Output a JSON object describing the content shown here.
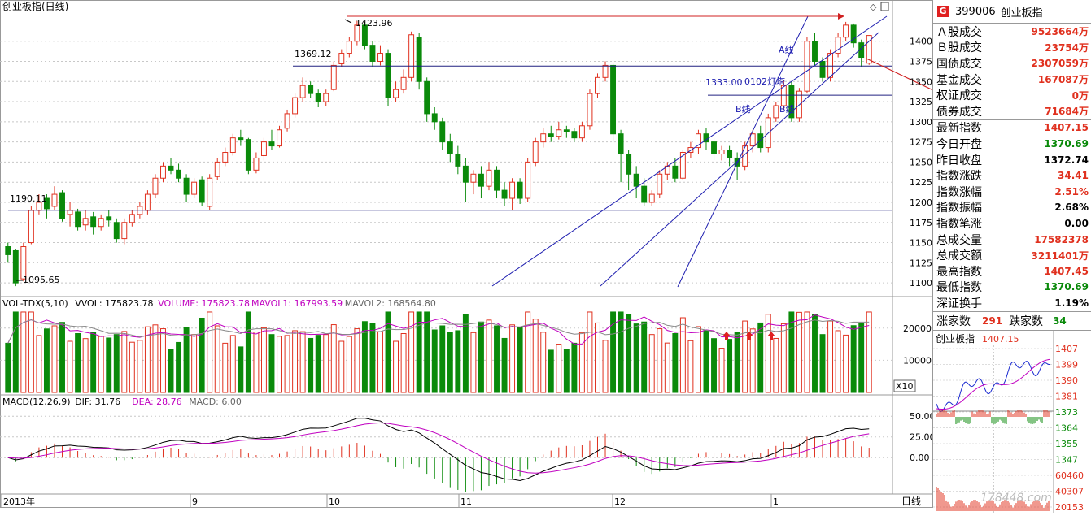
{
  "chart_data": {
    "type": "candlestick",
    "title": "创业板指(日线)",
    "xlabels": [
      "2013年",
      "9",
      "10",
      "11",
      "12",
      "1"
    ],
    "period_label": "日线",
    "yticks": [
      1100,
      1125,
      1150,
      1175,
      1200,
      1225,
      1250,
      1275,
      1300,
      1325,
      1350,
      1375,
      1400
    ],
    "ylim": [
      1085,
      1436
    ],
    "annotations": [
      {
        "text": "1423.96",
        "value": 1423.96
      },
      {
        "text": "1369.12",
        "value": 1369.12
      },
      {
        "text": "1190.11",
        "value": 1190.11
      },
      {
        "text": "1095.65",
        "value": 1095.65
      },
      {
        "text": "1333.00",
        "value": 1333.0
      },
      {
        "text": "0102灯塔",
        "value": 1344
      },
      {
        "text": "A线",
        "value": 1383
      },
      {
        "text": "B线",
        "value": 1303
      },
      {
        "text": "B线",
        "value": 1303
      }
    ],
    "hlines": [
      1369.12,
      1190.11,
      1333.0
    ],
    "candles": [
      {
        "o": 1145,
        "c": 1135,
        "h": 1150,
        "l": 1125
      },
      {
        "o": 1140,
        "c": 1100,
        "h": 1142,
        "l": 1096
      },
      {
        "o": 1105,
        "c": 1145,
        "h": 1150,
        "l": 1102
      },
      {
        "o": 1150,
        "c": 1190,
        "h": 1195,
        "l": 1148
      },
      {
        "o": 1190,
        "c": 1200,
        "h": 1210,
        "l": 1185
      },
      {
        "o": 1205,
        "c": 1192,
        "h": 1210,
        "l": 1180
      },
      {
        "o": 1195,
        "c": 1210,
        "h": 1220,
        "l": 1190
      },
      {
        "o": 1212,
        "c": 1180,
        "h": 1215,
        "l": 1176
      },
      {
        "o": 1185,
        "c": 1190,
        "h": 1200,
        "l": 1170
      },
      {
        "o": 1188,
        "c": 1170,
        "h": 1192,
        "l": 1165
      },
      {
        "o": 1172,
        "c": 1180,
        "h": 1190,
        "l": 1165
      },
      {
        "o": 1182,
        "c": 1170,
        "h": 1188,
        "l": 1160
      },
      {
        "o": 1170,
        "c": 1180,
        "h": 1185,
        "l": 1165
      },
      {
        "o": 1182,
        "c": 1178,
        "h": 1190,
        "l": 1170
      },
      {
        "o": 1175,
        "c": 1155,
        "h": 1180,
        "l": 1150
      },
      {
        "o": 1155,
        "c": 1175,
        "h": 1180,
        "l": 1148
      },
      {
        "o": 1175,
        "c": 1185,
        "h": 1190,
        "l": 1170
      },
      {
        "o": 1185,
        "c": 1195,
        "h": 1200,
        "l": 1180
      },
      {
        "o": 1190,
        "c": 1210,
        "h": 1215,
        "l": 1185
      },
      {
        "o": 1210,
        "c": 1230,
        "h": 1235,
        "l": 1205
      },
      {
        "o": 1230,
        "c": 1245,
        "h": 1250,
        "l": 1225
      },
      {
        "o": 1245,
        "c": 1240,
        "h": 1255,
        "l": 1235
      },
      {
        "o": 1240,
        "c": 1230,
        "h": 1248,
        "l": 1225
      },
      {
        "o": 1230,
        "c": 1210,
        "h": 1235,
        "l": 1200
      },
      {
        "o": 1210,
        "c": 1225,
        "h": 1230,
        "l": 1205
      },
      {
        "o": 1228,
        "c": 1200,
        "h": 1232,
        "l": 1195
      },
      {
        "o": 1195,
        "c": 1230,
        "h": 1235,
        "l": 1190
      },
      {
        "o": 1232,
        "c": 1250,
        "h": 1255,
        "l": 1228
      },
      {
        "o": 1250,
        "c": 1262,
        "h": 1268,
        "l": 1245
      },
      {
        "o": 1262,
        "c": 1280,
        "h": 1285,
        "l": 1258
      },
      {
        "o": 1280,
        "c": 1278,
        "h": 1290,
        "l": 1270
      },
      {
        "o": 1278,
        "c": 1240,
        "h": 1280,
        "l": 1235
      },
      {
        "o": 1240,
        "c": 1255,
        "h": 1262,
        "l": 1236
      },
      {
        "o": 1258,
        "c": 1275,
        "h": 1280,
        "l": 1252
      },
      {
        "o": 1275,
        "c": 1270,
        "h": 1290,
        "l": 1265
      },
      {
        "o": 1270,
        "c": 1290,
        "h": 1295,
        "l": 1268
      },
      {
        "o": 1292,
        "c": 1310,
        "h": 1315,
        "l": 1288
      },
      {
        "o": 1310,
        "c": 1330,
        "h": 1335,
        "l": 1305
      },
      {
        "o": 1330,
        "c": 1345,
        "h": 1355,
        "l": 1325
      },
      {
        "o": 1345,
        "c": 1335,
        "h": 1350,
        "l": 1330
      },
      {
        "o": 1335,
        "c": 1325,
        "h": 1340,
        "l": 1318
      },
      {
        "o": 1325,
        "c": 1335,
        "h": 1340,
        "l": 1320
      },
      {
        "o": 1340,
        "c": 1370,
        "h": 1375,
        "l": 1338
      },
      {
        "o": 1372,
        "c": 1385,
        "h": 1390,
        "l": 1368
      },
      {
        "o": 1385,
        "c": 1400,
        "h": 1405,
        "l": 1380
      },
      {
        "o": 1400,
        "c": 1420,
        "h": 1425,
        "l": 1395
      },
      {
        "o": 1420,
        "c": 1395,
        "h": 1424,
        "l": 1390
      },
      {
        "o": 1395,
        "c": 1375,
        "h": 1400,
        "l": 1368
      },
      {
        "o": 1375,
        "c": 1385,
        "h": 1395,
        "l": 1370
      },
      {
        "o": 1385,
        "c": 1330,
        "h": 1390,
        "l": 1320
      },
      {
        "o": 1330,
        "c": 1340,
        "h": 1350,
        "l": 1325
      },
      {
        "o": 1340,
        "c": 1355,
        "h": 1365,
        "l": 1335
      },
      {
        "o": 1355,
        "c": 1408,
        "h": 1412,
        "l": 1350
      },
      {
        "o": 1405,
        "c": 1350,
        "h": 1410,
        "l": 1340
      },
      {
        "o": 1350,
        "c": 1310,
        "h": 1355,
        "l": 1300
      },
      {
        "o": 1310,
        "c": 1300,
        "h": 1318,
        "l": 1290
      },
      {
        "o": 1300,
        "c": 1275,
        "h": 1305,
        "l": 1265
      },
      {
        "o": 1275,
        "c": 1260,
        "h": 1285,
        "l": 1250
      },
      {
        "o": 1260,
        "c": 1245,
        "h": 1270,
        "l": 1235
      },
      {
        "o": 1245,
        "c": 1225,
        "h": 1255,
        "l": 1200
      },
      {
        "o": 1225,
        "c": 1235,
        "h": 1240,
        "l": 1210
      },
      {
        "o": 1235,
        "c": 1220,
        "h": 1245,
        "l": 1205
      },
      {
        "o": 1220,
        "c": 1240,
        "h": 1250,
        "l": 1215
      },
      {
        "o": 1240,
        "c": 1215,
        "h": 1245,
        "l": 1205
      },
      {
        "o": 1215,
        "c": 1205,
        "h": 1225,
        "l": 1195
      },
      {
        "o": 1205,
        "c": 1225,
        "h": 1230,
        "l": 1190
      },
      {
        "o": 1225,
        "c": 1205,
        "h": 1230,
        "l": 1198
      },
      {
        "o": 1205,
        "c": 1250,
        "h": 1255,
        "l": 1200
      },
      {
        "o": 1250,
        "c": 1275,
        "h": 1280,
        "l": 1245
      },
      {
        "o": 1275,
        "c": 1285,
        "h": 1292,
        "l": 1268
      },
      {
        "o": 1285,
        "c": 1282,
        "h": 1295,
        "l": 1275
      },
      {
        "o": 1282,
        "c": 1290,
        "h": 1300,
        "l": 1278
      },
      {
        "o": 1290,
        "c": 1288,
        "h": 1295,
        "l": 1280
      },
      {
        "o": 1288,
        "c": 1280,
        "h": 1292,
        "l": 1275
      },
      {
        "o": 1280,
        "c": 1295,
        "h": 1300,
        "l": 1275
      },
      {
        "o": 1295,
        "c": 1335,
        "h": 1340,
        "l": 1290
      },
      {
        "o": 1335,
        "c": 1355,
        "h": 1360,
        "l": 1330
      },
      {
        "o": 1355,
        "c": 1370,
        "h": 1375,
        "l": 1350
      },
      {
        "o": 1370,
        "c": 1285,
        "h": 1372,
        "l": 1275
      },
      {
        "o": 1285,
        "c": 1260,
        "h": 1290,
        "l": 1225
      },
      {
        "o": 1260,
        "c": 1235,
        "h": 1265,
        "l": 1215
      },
      {
        "o": 1235,
        "c": 1220,
        "h": 1245,
        "l": 1205
      },
      {
        "o": 1220,
        "c": 1200,
        "h": 1230,
        "l": 1195
      },
      {
        "o": 1200,
        "c": 1210,
        "h": 1215,
        "l": 1195
      },
      {
        "o": 1210,
        "c": 1235,
        "h": 1240,
        "l": 1205
      },
      {
        "o": 1235,
        "c": 1245,
        "h": 1250,
        "l": 1228
      },
      {
        "o": 1245,
        "c": 1230,
        "h": 1255,
        "l": 1225
      },
      {
        "o": 1230,
        "c": 1262,
        "h": 1265,
        "l": 1228
      },
      {
        "o": 1262,
        "c": 1268,
        "h": 1275,
        "l": 1255
      },
      {
        "o": 1268,
        "c": 1285,
        "h": 1290,
        "l": 1260
      },
      {
        "o": 1285,
        "c": 1275,
        "h": 1292,
        "l": 1265
      },
      {
        "o": 1275,
        "c": 1260,
        "h": 1280,
        "l": 1252
      },
      {
        "o": 1260,
        "c": 1265,
        "h": 1270,
        "l": 1252
      },
      {
        "o": 1265,
        "c": 1255,
        "h": 1270,
        "l": 1245
      },
      {
        "o": 1255,
        "c": 1245,
        "h": 1262,
        "l": 1228
      },
      {
        "o": 1245,
        "c": 1270,
        "h": 1275,
        "l": 1240
      },
      {
        "o": 1270,
        "c": 1285,
        "h": 1290,
        "l": 1262
      },
      {
        "o": 1285,
        "c": 1268,
        "h": 1295,
        "l": 1262
      },
      {
        "o": 1268,
        "c": 1305,
        "h": 1310,
        "l": 1262
      },
      {
        "o": 1305,
        "c": 1320,
        "h": 1325,
        "l": 1300
      },
      {
        "o": 1320,
        "c": 1345,
        "h": 1352,
        "l": 1315
      },
      {
        "o": 1345,
        "c": 1305,
        "h": 1350,
        "l": 1300
      },
      {
        "o": 1305,
        "c": 1338,
        "h": 1342,
        "l": 1300
      },
      {
        "o": 1338,
        "c": 1400,
        "h": 1405,
        "l": 1335
      },
      {
        "o": 1400,
        "c": 1375,
        "h": 1410,
        "l": 1370
      },
      {
        "o": 1375,
        "c": 1355,
        "h": 1380,
        "l": 1350
      },
      {
        "o": 1355,
        "c": 1385,
        "h": 1390,
        "l": 1350
      },
      {
        "o": 1385,
        "c": 1405,
        "h": 1410,
        "l": 1380
      },
      {
        "o": 1405,
        "c": 1420,
        "h": 1424,
        "l": 1400
      },
      {
        "o": 1420,
        "c": 1398,
        "h": 1422,
        "l": 1392
      },
      {
        "o": 1398,
        "c": 1380,
        "h": 1402,
        "l": 1368
      },
      {
        "o": 1372.74,
        "c": 1407.15,
        "h": 1407.45,
        "l": 1370.69
      }
    ],
    "volume": {
      "title": "VOL-TDX(5,10)",
      "vvol": "VVOL: 175823.78",
      "volume": "VOLUME: 175823.78",
      "mavol1": "MAVOL1: 167993.59",
      "mavol2": "MAVOL2: 168564.80",
      "yticks": [
        10000,
        20000
      ],
      "ymax": 26000,
      "unit_badge": "X10"
    },
    "macd": {
      "title": "MACD(12,26,9)",
      "dif": "DIF: 31.76",
      "dea": "DEA: 28.76",
      "macd": "MACD: 6.00",
      "yticks": [
        0,
        25,
        50
      ],
      "ylim": [
        -42,
        62
      ]
    }
  },
  "side": {
    "code": "399006",
    "name": "创业板指",
    "flag": "G",
    "sec1": [
      {
        "k": "Ａ股成交",
        "v": "9523664万",
        "c": "red"
      },
      {
        "k": "Ｂ股成交",
        "v": "23754万",
        "c": "red"
      },
      {
        "k": "国债成交",
        "v": "2307059万",
        "c": "red"
      },
      {
        "k": "基金成交",
        "v": "167087万",
        "c": "red"
      },
      {
        "k": "权证成交",
        "v": "0万",
        "c": "red"
      },
      {
        "k": "债券成交",
        "v": "71684万",
        "c": "red"
      }
    ],
    "sec2": [
      {
        "k": "最新指数",
        "v": "1407.15",
        "c": "red"
      },
      {
        "k": "今日开盘",
        "v": "1370.69",
        "c": "grn"
      },
      {
        "k": "昨日收盘",
        "v": "1372.74",
        "c": "blk"
      },
      {
        "k": "指数涨跌",
        "v": "34.41",
        "c": "red"
      },
      {
        "k": "指数涨幅",
        "v": "2.51%",
        "c": "red"
      },
      {
        "k": "指数振幅",
        "v": "2.68%",
        "c": "blk"
      },
      {
        "k": "指数笔涨",
        "v": "0.00",
        "c": "blk"
      },
      {
        "k": "总成交量",
        "v": "17582378",
        "c": "red"
      },
      {
        "k": "总成交额",
        "v": "3211401万",
        "c": "red"
      },
      {
        "k": "最高指数",
        "v": "1407.45",
        "c": "red"
      },
      {
        "k": "最低指数",
        "v": "1370.69",
        "c": "grn"
      },
      {
        "k": "深证换手",
        "v": "1.19%",
        "c": "blk"
      }
    ],
    "up_label": "涨家数",
    "up_count": "291",
    "down_label": "跌家数",
    "down_count": "34",
    "mini_title": "创业板指",
    "mini_price": "1407.15",
    "mini_ticks_right": [
      "1407",
      "1399",
      "1390",
      "1381",
      "1373",
      "1364",
      "1355",
      "1347",
      "60460",
      "40307",
      "20153"
    ],
    "watermark": "178448.com"
  },
  "colors": {
    "up": "#e0301e",
    "down": "#0a8a0a",
    "grid": "#c8c8c8",
    "trend": "#2020b0"
  }
}
